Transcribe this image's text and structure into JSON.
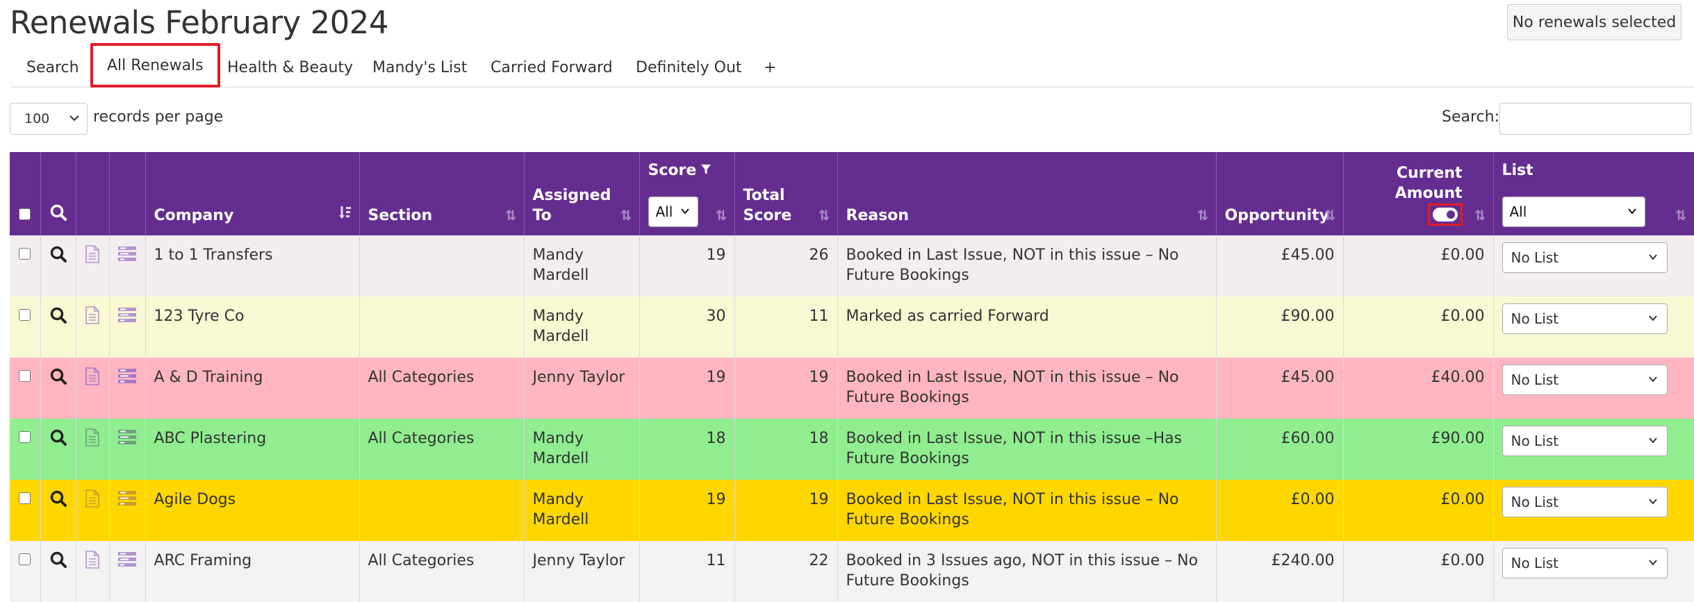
{
  "page": {
    "title": "Renewals February 2024",
    "selection_status": "No renewals selected"
  },
  "tabs": [
    {
      "label": "Search"
    },
    {
      "label": "All Renewals"
    },
    {
      "label": "Health & Beauty"
    },
    {
      "label": "Mandy's List"
    },
    {
      "label": "Carried Forward"
    },
    {
      "label": "Definitely Out"
    },
    {
      "label": "+"
    }
  ],
  "controls": {
    "records_per_page": "100",
    "records_per_page_label": "records per page",
    "search_label": "Search:",
    "search_value": ""
  },
  "columns": {
    "company": "Company",
    "section": "Section",
    "assigned_to": "Assigned To",
    "score": "Score",
    "score_filter": "All",
    "total_score": "Total Score",
    "reason": "Reason",
    "opportunity": "Opportunity",
    "current_amount": "Current Amount",
    "list": "List",
    "list_filter": "All"
  },
  "colors": {
    "header": "#662d91",
    "highlight": "#e11d25"
  },
  "rows": [
    {
      "company": "1 to 1 Transfers",
      "section": "",
      "assigned_to": "Mandy Mardell",
      "score": "19",
      "total_score": "26",
      "reason": "Booked in Last Issue, NOT in this issue – No Future Bookings",
      "opportunity": "£45.00",
      "current_amount": "£0.00",
      "list": "No List",
      "bg": "#f3eeee",
      "icon_color": "#b393cf"
    },
    {
      "company": "123 Tyre Co",
      "section": "",
      "assigned_to": "Mandy Mardell",
      "score": "30",
      "total_score": "11",
      "reason": "Marked as carried Forward",
      "opportunity": "£90.00",
      "current_amount": "£0.00",
      "list": "No List",
      "bg": "#f8f8d3",
      "icon_color": "#b393cf"
    },
    {
      "company": "A & D Training",
      "section": "All Categories",
      "assigned_to": "Jenny Taylor",
      "score": "19",
      "total_score": "19",
      "reason": "Booked in Last Issue, NOT in this issue – No Future Bookings",
      "opportunity": "£45.00",
      "current_amount": "£40.00",
      "list": "No List",
      "bg": "#ffb6c2",
      "icon_color": "#a878c7"
    },
    {
      "company": "ABC Plastering",
      "section": "All Categories",
      "assigned_to": "Mandy Mardell",
      "score": "18",
      "total_score": "18",
      "reason": "Booked in Last Issue, NOT in this issue –Has Future Bookings",
      "opportunity": "£60.00",
      "current_amount": "£90.00",
      "list": "No List",
      "bg": "#90ee90",
      "icon_color": "#6f9f7f"
    },
    {
      "company": "Agile Dogs",
      "section": "",
      "assigned_to": "Mandy Mardell",
      "score": "19",
      "total_score": "19",
      "reason": "Booked in Last Issue, NOT in this issue – No Future Bookings",
      "opportunity": "£0.00",
      "current_amount": "£0.00",
      "list": "No List",
      "bg": "#ffd700",
      "icon_color": "#c99a2e"
    },
    {
      "company": "ARC Framing",
      "section": "All Categories",
      "assigned_to": "Jenny Taylor",
      "score": "11",
      "total_score": "22",
      "reason": "Booked in 3 Issues ago, NOT in this issue – No Future Bookings",
      "opportunity": "£240.00",
      "current_amount": "£0.00",
      "list": "No List",
      "bg": "#f2f2f2",
      "icon_color": "#b393cf"
    }
  ]
}
